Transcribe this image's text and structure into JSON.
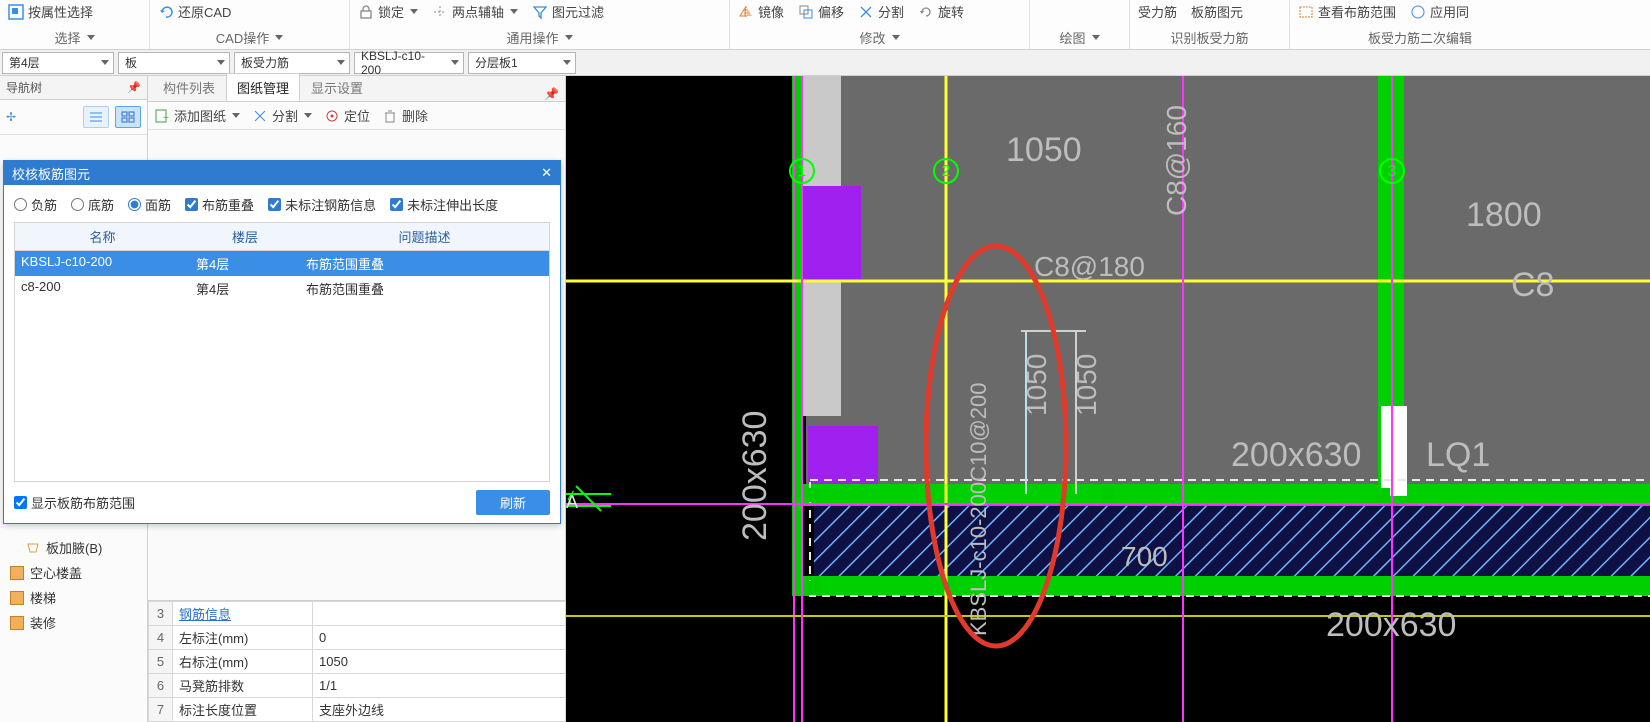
{
  "ribbon": {
    "g1": {
      "btn": "按属性选择",
      "title": "选择"
    },
    "g2": {
      "btn": "还原CAD",
      "title": "CAD操作"
    },
    "g3": {
      "btns": [
        "锁定",
        "两点辅轴",
        "图元过滤"
      ],
      "title": "通用操作"
    },
    "g4": {
      "btns": [
        "镜像",
        "偏移",
        "分割",
        "旋转"
      ],
      "title": "修改"
    },
    "g5": {
      "title": "绘图"
    },
    "g6": {
      "btns": [
        "受力筋",
        "板筋图元"
      ],
      "title": "识别板受力筋"
    },
    "g7": {
      "btns": [
        "查看布筋范围",
        "应用同"
      ],
      "title": "板受力筋二次编辑"
    }
  },
  "dropdowns": {
    "floor": "第4层",
    "cat": "板",
    "type": "板受力筋",
    "item": "KBSLJ-c10-200",
    "layer": "分层板1"
  },
  "nav": {
    "title": "导航树",
    "items": [
      {
        "label": "板加腋(B)",
        "icon": true
      },
      {
        "label": "空心楼盖"
      },
      {
        "label": "楼梯"
      },
      {
        "label": "装修"
      }
    ]
  },
  "tabs": {
    "a": "构件列表",
    "b": "图纸管理",
    "c": "显示设置"
  },
  "toolbar2": {
    "add": "添加图纸",
    "split": "分割",
    "locate": "定位",
    "del": "删除"
  },
  "dialog": {
    "title": "校核板筋图元",
    "opts": {
      "neg": "负筋",
      "btm": "底筋",
      "top": "面筋",
      "ov": "布筋重叠",
      "noSteel": "未标注钢筋信息",
      "noExt": "未标注伸出长度"
    },
    "cols": {
      "a": "名称",
      "b": "楼层",
      "c": "问题描述"
    },
    "rows": [
      {
        "a": "KBSLJ-c10-200",
        "b": "第4层",
        "c": "布筋范围重叠",
        "sel": true
      },
      {
        "a": "c8-200",
        "b": "第4层",
        "c": "布筋范围重叠"
      }
    ],
    "showRange": "显示板筋布筋范围",
    "refresh": "刷新"
  },
  "props": {
    "rows": [
      {
        "n": "3",
        "lbl": "钢筋信息",
        "link": true,
        "val": ""
      },
      {
        "n": "4",
        "lbl": "左标注(mm)",
        "val": "0"
      },
      {
        "n": "5",
        "lbl": "右标注(mm)",
        "val": "1050"
      },
      {
        "n": "6",
        "lbl": "马凳筋排数",
        "val": "1/1"
      },
      {
        "n": "7",
        "lbl": "标注长度位置",
        "val": "支座外边线"
      }
    ]
  },
  "canvas": {
    "ax1": "1",
    "ax2": "2",
    "ax3": "3",
    "A": "A",
    "dim1800": "1800",
    "dim1050a": "1050",
    "dim1050b": "1050",
    "beam1": "200x630",
    "beam2": "200x630",
    "beam3": "200x630",
    "c8_180": "C8@180",
    "c8_160": "C8@160",
    "lq1": "LQ1",
    "dim700": "700",
    "dim1050top": "1050",
    "labelKBSLJ": "KBSLJ-c10-200C10@200"
  }
}
